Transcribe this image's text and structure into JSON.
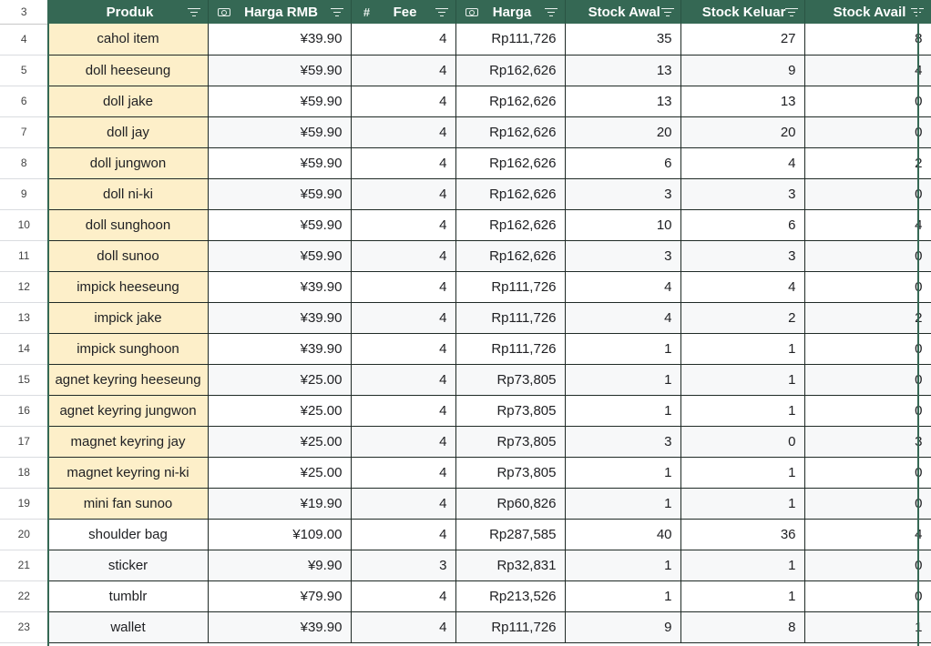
{
  "header": {
    "row_number": "3",
    "columns": [
      {
        "key": "produk",
        "label": "Produk",
        "type_icon": "none"
      },
      {
        "key": "harga_rmb",
        "label": "Harga RMB",
        "type_icon": "currency-icon"
      },
      {
        "key": "fee",
        "label": "Fee",
        "type_icon": "hash-icon"
      },
      {
        "key": "harga",
        "label": "Harga",
        "type_icon": "currency-icon"
      },
      {
        "key": "stock_awal",
        "label": "Stock Awal",
        "type_icon": "none"
      },
      {
        "key": "stock_keluar",
        "label": "Stock Keluar",
        "type_icon": "none"
      },
      {
        "key": "stock_avail",
        "label": "Stock Avail",
        "type_icon": "none"
      }
    ],
    "hash_symbol": "#"
  },
  "colors": {
    "header_bg": "#356854",
    "highlight": "#fdefc9"
  },
  "rows": [
    {
      "n": "4",
      "produk": "cahol item",
      "rmb": "¥39.90",
      "fee": "4",
      "harga": "Rp111,726",
      "awal": "35",
      "keluar": "27",
      "avail": "8",
      "hl": true
    },
    {
      "n": "5",
      "produk": "doll heeseung",
      "rmb": "¥59.90",
      "fee": "4",
      "harga": "Rp162,626",
      "awal": "13",
      "keluar": "9",
      "avail": "4",
      "hl": true
    },
    {
      "n": "6",
      "produk": "doll jake",
      "rmb": "¥59.90",
      "fee": "4",
      "harga": "Rp162,626",
      "awal": "13",
      "keluar": "13",
      "avail": "0",
      "hl": true
    },
    {
      "n": "7",
      "produk": "doll jay",
      "rmb": "¥59.90",
      "fee": "4",
      "harga": "Rp162,626",
      "awal": "20",
      "keluar": "20",
      "avail": "0",
      "hl": true
    },
    {
      "n": "8",
      "produk": "doll jungwon",
      "rmb": "¥59.90",
      "fee": "4",
      "harga": "Rp162,626",
      "awal": "6",
      "keluar": "4",
      "avail": "2",
      "hl": true
    },
    {
      "n": "9",
      "produk": "doll ni-ki",
      "rmb": "¥59.90",
      "fee": "4",
      "harga": "Rp162,626",
      "awal": "3",
      "keluar": "3",
      "avail": "0",
      "hl": true
    },
    {
      "n": "10",
      "produk": "doll sunghoon",
      "rmb": "¥59.90",
      "fee": "4",
      "harga": "Rp162,626",
      "awal": "10",
      "keluar": "6",
      "avail": "4",
      "hl": true
    },
    {
      "n": "11",
      "produk": "doll sunoo",
      "rmb": "¥59.90",
      "fee": "4",
      "harga": "Rp162,626",
      "awal": "3",
      "keluar": "3",
      "avail": "0",
      "hl": true
    },
    {
      "n": "12",
      "produk": "impick heeseung",
      "rmb": "¥39.90",
      "fee": "4",
      "harga": "Rp111,726",
      "awal": "4",
      "keluar": "4",
      "avail": "0",
      "hl": true
    },
    {
      "n": "13",
      "produk": "impick jake",
      "rmb": "¥39.90",
      "fee": "4",
      "harga": "Rp111,726",
      "awal": "4",
      "keluar": "2",
      "avail": "2",
      "hl": true
    },
    {
      "n": "14",
      "produk": "impick sunghoon",
      "rmb": "¥39.90",
      "fee": "4",
      "harga": "Rp111,726",
      "awal": "1",
      "keluar": "1",
      "avail": "0",
      "hl": true
    },
    {
      "n": "15",
      "produk": "agnet keyring heeseung",
      "rmb": "¥25.00",
      "fee": "4",
      "harga": "Rp73,805",
      "awal": "1",
      "keluar": "1",
      "avail": "0",
      "hl": true
    },
    {
      "n": "16",
      "produk": "agnet keyring jungwon",
      "rmb": "¥25.00",
      "fee": "4",
      "harga": "Rp73,805",
      "awal": "1",
      "keluar": "1",
      "avail": "0",
      "hl": true
    },
    {
      "n": "17",
      "produk": "magnet keyring jay",
      "rmb": "¥25.00",
      "fee": "4",
      "harga": "Rp73,805",
      "awal": "3",
      "keluar": "0",
      "avail": "3",
      "hl": true
    },
    {
      "n": "18",
      "produk": "magnet keyring ni-ki",
      "rmb": "¥25.00",
      "fee": "4",
      "harga": "Rp73,805",
      "awal": "1",
      "keluar": "1",
      "avail": "0",
      "hl": true
    },
    {
      "n": "19",
      "produk": "mini fan sunoo",
      "rmb": "¥19.90",
      "fee": "4",
      "harga": "Rp60,826",
      "awal": "1",
      "keluar": "1",
      "avail": "0",
      "hl": true
    },
    {
      "n": "20",
      "produk": "shoulder bag",
      "rmb": "¥109.00",
      "fee": "4",
      "harga": "Rp287,585",
      "awal": "40",
      "keluar": "36",
      "avail": "4",
      "hl": false
    },
    {
      "n": "21",
      "produk": "sticker",
      "rmb": "¥9.90",
      "fee": "3",
      "harga": "Rp32,831",
      "awal": "1",
      "keluar": "1",
      "avail": "0",
      "hl": false
    },
    {
      "n": "22",
      "produk": "tumblr",
      "rmb": "¥79.90",
      "fee": "4",
      "harga": "Rp213,526",
      "awal": "1",
      "keluar": "1",
      "avail": "0",
      "hl": false
    },
    {
      "n": "23",
      "produk": "wallet",
      "rmb": "¥39.90",
      "fee": "4",
      "harga": "Rp111,726",
      "awal": "9",
      "keluar": "8",
      "avail": "1",
      "hl": false
    }
  ]
}
